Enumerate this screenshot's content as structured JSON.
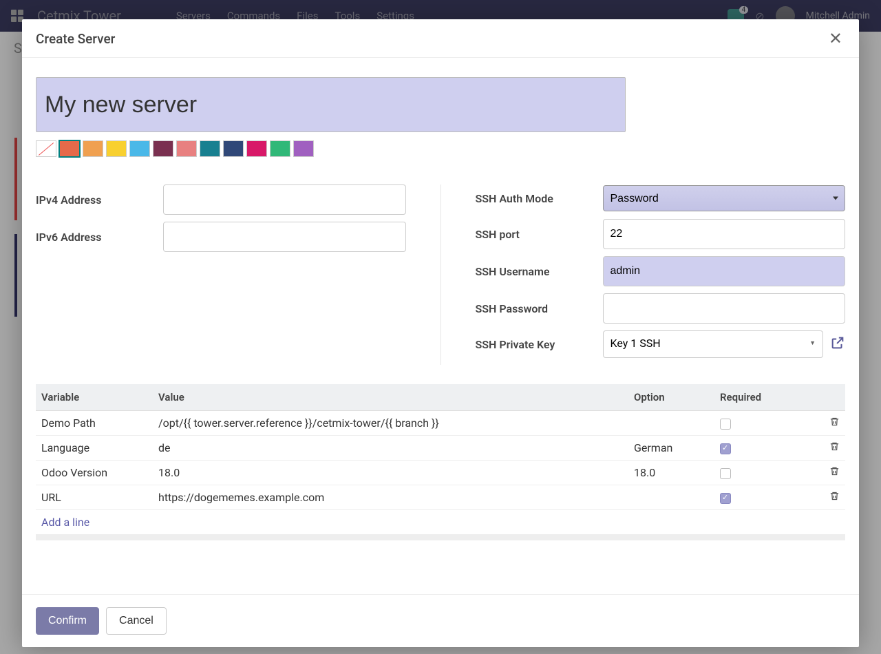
{
  "topbar": {
    "brand": "Cetmix Tower",
    "nav": [
      "Servers",
      "Commands",
      "Files",
      "Tools",
      "Settings"
    ],
    "chat_badge": "4",
    "username": "Mitchell Admin"
  },
  "background_page": {
    "label": "Se"
  },
  "modal": {
    "title": "Create Server",
    "name_value": "My new server",
    "colors": [
      {
        "value": "none",
        "selected": false
      },
      {
        "value": "#e66a4a",
        "selected": true
      },
      {
        "value": "#f0a050",
        "selected": false
      },
      {
        "value": "#f8d030",
        "selected": false
      },
      {
        "value": "#4ab8e8",
        "selected": false
      },
      {
        "value": "#7a3050",
        "selected": false
      },
      {
        "value": "#e88080",
        "selected": false
      },
      {
        "value": "#188090",
        "selected": false
      },
      {
        "value": "#304878",
        "selected": false
      },
      {
        "value": "#d81868",
        "selected": false
      },
      {
        "value": "#30b878",
        "selected": false
      },
      {
        "value": "#a060c0",
        "selected": false
      }
    ],
    "left_fields": {
      "ipv4_label": "IPv4 Address",
      "ipv4_value": "",
      "ipv6_label": "IPv6 Address",
      "ipv6_value": ""
    },
    "right_fields": {
      "auth_mode_label": "SSH Auth Mode",
      "auth_mode_value": "Password",
      "port_label": "SSH port",
      "port_value": "22",
      "user_label": "SSH Username",
      "user_value": "admin",
      "pass_label": "SSH Password",
      "pass_value": "",
      "key_label": "SSH Private Key",
      "key_value": "Key 1 SSH"
    },
    "table": {
      "headers": {
        "variable": "Variable",
        "value": "Value",
        "option": "Option",
        "required": "Required"
      },
      "rows": [
        {
          "variable": "Demo Path",
          "value": "/opt/{{ tower.server.reference }}/cetmix-tower/{{ branch }}",
          "option": "",
          "required": false
        },
        {
          "variable": "Language",
          "value": "de",
          "option": "German",
          "required": true
        },
        {
          "variable": "Odoo Version",
          "value": "18.0",
          "option": "18.0",
          "required": false
        },
        {
          "variable": "URL",
          "value": "https://dogememes.example.com",
          "option": "",
          "required": true
        }
      ],
      "add_line": "Add a line"
    },
    "footer": {
      "confirm": "Confirm",
      "cancel": "Cancel"
    }
  }
}
